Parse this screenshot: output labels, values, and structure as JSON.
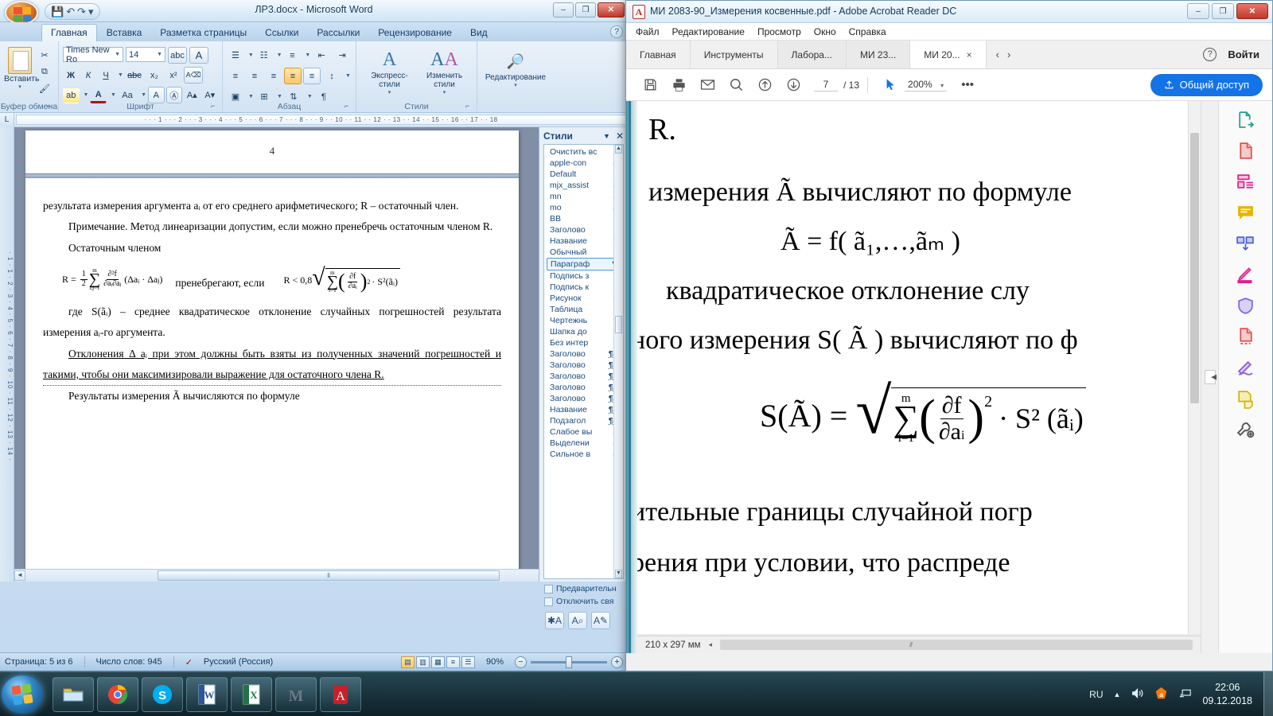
{
  "word": {
    "title": "ЛР3.docx - Microsoft Word",
    "quick_access": {
      "save": "💾",
      "undo": "↶",
      "redo": "↷",
      "more": "▾"
    },
    "window_buttons": {
      "minimize": "–",
      "maximize": "❐",
      "close": "✕"
    },
    "tabs": [
      {
        "label": "Главная",
        "active": true
      },
      {
        "label": "Вставка",
        "active": false
      },
      {
        "label": "Разметка страницы",
        "active": false
      },
      {
        "label": "Ссылки",
        "active": false
      },
      {
        "label": "Рассылки",
        "active": false
      },
      {
        "label": "Рецензирование",
        "active": false
      },
      {
        "label": "Вид",
        "active": false
      }
    ],
    "help_label": "?",
    "ribbon": {
      "clipboard": {
        "label": "Буфер обмена",
        "paste": "Вставить",
        "cut": "✂",
        "copy": "⧉",
        "format_painter": "🖌"
      },
      "font": {
        "label": "Шрифт",
        "font_name": "Times New Ro",
        "font_size": "14",
        "bold": "Ж",
        "italic": "К",
        "underline": "Ч",
        "strike": "abc",
        "subscript": "x₂",
        "superscript": "x²",
        "clear_format": "A",
        "change_case": "Aa",
        "text_highlight": "ab",
        "font_color": "A",
        "grow_font": "A▴",
        "shrink_font": "A▾",
        "text_effects": "A",
        "enclose": "Ⓐ"
      },
      "paragraph": {
        "label": "Абзац",
        "bullets": "☰",
        "numbering": "☷",
        "multilevel": "≡",
        "decrease_indent": "⇤",
        "increase_indent": "⇥",
        "align_left": "≡",
        "align_center": "≡",
        "align_right": "≡",
        "justify": "≡",
        "line_spacing": "↕",
        "shading": "▣",
        "borders": "⊞",
        "sort": "⇅",
        "show_marks": "¶"
      },
      "styles": {
        "label": "Стили",
        "quick_styles": "Экспресс-стили",
        "change_styles": "Изменить стили"
      },
      "editing": {
        "label": "Редактирование",
        "find": "Редактирование"
      }
    },
    "ruler": {
      "tab_selector": "L",
      "horizontal": "· · · 1 · · · 2 · · · 3 · · · 4 · · · 5 · · · 6 · · · 7 · · · 8 · · · 9 · · 10 · · 11 · · 12 · · 13 · · 14 · · 15 · · 16 · · 17 · · 18",
      "vertical": "· 1 · 1 · 2 · 3 · 4 · 5 · 6 · 7 · 8 · 9 · 10 · 11 · 12 · 13 · 14 ·"
    },
    "document": {
      "page_number_header": "4",
      "paragraphs": [
        "результата измерения аргумента aᵢ от его среднего арифметического; R – остаточный член.",
        "Примечание. Метод линеаризации допустим, если можно пренебречь остаточным членом R.",
        "Остаточным членом",
        "пренебрегают, если",
        "где S(ãᵢ) – среднее квадратическое отклонение случайных погрешностей результата измерения aᵢ-го аргумента.",
        "Отклонения Δ aᵢ при этом должны быть взяты из полученных значений погрешностей и такими, чтобы они максимизировали выражение для остаточного члена R.",
        "Результаты измерения Ã вычисляются по формуле"
      ],
      "formula_left": "R = 1/2 ∑(i,j=1..m) ∂²f/∂aᵢ∂aⱼ (Δaᵢ · Δaⱼ)",
      "formula_right": "R < 0,8 √(∑(i=1..m) (∂f/∂aᵢ)² · S²(ãᵢ))",
      "formula_parts": {
        "R": "R",
        "eq": "=",
        "half_num": "1",
        "half_den": "2",
        "sigma": "∑",
        "sigma_top": "m",
        "sigma_bot": "i,j=1",
        "d2f": "∂²f",
        "dadaj": "∂aᵢ∂aⱼ",
        "delta_expr": "(Δaᵢ · Δaⱼ)",
        "rlt": "R < 0,8",
        "radical": "√",
        "sigma2_top": "m",
        "sigma2_bot": "i=1",
        "df": "∂f",
        "dai": "∂aᵢ",
        "pow2": "2",
        "s2ai": "· S²(ãᵢ)"
      }
    },
    "styles_pane": {
      "title": "Стили",
      "dropdown": "▼",
      "close": "✕",
      "items": [
        {
          "label": "Очистить вс",
          "mark": ""
        },
        {
          "label": "apple-con",
          "mark": "a"
        },
        {
          "label": "Default",
          "mark": "¶"
        },
        {
          "label": "mjx_assist",
          "mark": "a"
        },
        {
          "label": "mn",
          "mark": "a"
        },
        {
          "label": "mo",
          "mark": "a"
        },
        {
          "label": "BB",
          "mark": "¶"
        },
        {
          "label": "Заголово",
          "mark": "¶"
        },
        {
          "label": "Название",
          "mark": "¶"
        },
        {
          "label": "Обычный",
          "mark": "¶"
        },
        {
          "label": "Параграф",
          "mark": "¶",
          "selected": true
        },
        {
          "label": "Подпись з",
          "mark": "¶"
        },
        {
          "label": "Подпись к",
          "mark": "¶"
        },
        {
          "label": "Рисунок",
          "mark": "¶"
        },
        {
          "label": "Таблица",
          "mark": "¶"
        },
        {
          "label": "Чертежнь",
          "mark": "¶"
        },
        {
          "label": "Шапка до",
          "mark": "¶"
        },
        {
          "label": "Без интер",
          "mark": "¶"
        },
        {
          "label": "Заголово",
          "mark": "¶a"
        },
        {
          "label": "Заголово",
          "mark": "¶a"
        },
        {
          "label": "Заголово",
          "mark": "¶a"
        },
        {
          "label": "Заголово",
          "mark": "¶a"
        },
        {
          "label": "Заголово",
          "mark": "¶a"
        },
        {
          "label": "Название",
          "mark": "¶a"
        },
        {
          "label": "Подзагол",
          "mark": "¶a"
        },
        {
          "label": "Слабое вы",
          "mark": "a"
        },
        {
          "label": "Выделени",
          "mark": "a"
        },
        {
          "label": "Сильное в",
          "mark": "a"
        }
      ],
      "checkboxes": [
        {
          "label": "Предварительн"
        },
        {
          "label": "Отключить свя"
        }
      ],
      "buttons": [
        {
          "icon": "✱A",
          "name": "new-style"
        },
        {
          "icon": "A⌕",
          "name": "style-inspector"
        },
        {
          "icon": "A✎",
          "name": "manage-styles"
        }
      ]
    },
    "status_bar": {
      "page": "Страница: 5 из 6",
      "words": "Число слов: 945",
      "proofing_icon": "✓",
      "language": "Русский (Россия)",
      "zoom": "90%",
      "zoom_out": "−",
      "zoom_in": "+",
      "views": [
        "▤",
        "▥",
        "▦",
        "≡",
        "☰"
      ]
    }
  },
  "acrobat": {
    "title": "МИ 2083-90_Измерения косвенные.pdf - Adobe Acrobat Reader DC",
    "app_icon": "A",
    "window_buttons": {
      "minimize": "–",
      "maximize": "❐",
      "close": "✕"
    },
    "menu": [
      "Файл",
      "Редактирование",
      "Просмотр",
      "Окно",
      "Справка"
    ],
    "tabs": [
      {
        "label": "Главная",
        "type": "home"
      },
      {
        "label": "Инструменты",
        "type": "tools"
      },
      {
        "label": "Лабора...",
        "type": "doc"
      },
      {
        "label": "МИ 23...",
        "type": "doc"
      },
      {
        "label": "МИ 20...",
        "type": "doc",
        "active": true,
        "close": "×"
      }
    ],
    "nav": {
      "prev": "‹",
      "next": "›",
      "help": "?"
    },
    "sign_in": "Войти",
    "toolbar": {
      "save_icon": "save-icon",
      "print_icon": "print-icon",
      "email_icon": "email-icon",
      "search_icon": "search-icon",
      "prev_page_icon": "arrow-up-circle-icon",
      "next_page_icon": "arrow-down-circle-icon",
      "page_current": "7",
      "page_total": "/ 13",
      "select_tool": "cursor-icon",
      "zoom": "200%",
      "zoom_caret": "▾",
      "more": "•••",
      "share_label": "Общий доступ",
      "share_icon": "↑"
    },
    "pdf_content": {
      "lines": [
        "R.",
        "измерения Ã  вычисляют по формуле",
        "Ã = f( ã₁,…,ãₘ )",
        "квадратическое    отклонение    слу",
        "ного измерения S( Ã ) вычисляют по ф",
        "S(Ã) = √( ∑(i=1..m) (∂f/∂aᵢ)² · S²(ãᵢ) )",
        "ительные   границы   случайной   погр",
        "рения   при   условии,   что   распреде"
      ],
      "formula2": {
        "lhs": "S(Ã) =",
        "radical": "√",
        "sigma": "∑",
        "sigma_top": "m",
        "sigma_bot": "i=1",
        "num": "∂f",
        "den": "∂a",
        "den_sub": "i",
        "pow": "2",
        "tail": "· S² (ãᵢ)"
      },
      "formula1": "Ã = f( ã₁,…,ãₘ )"
    },
    "right_tools": [
      {
        "name": "export-pdf-icon",
        "color": "#2a9d8f"
      },
      {
        "name": "create-pdf-icon",
        "color": "#e05252"
      },
      {
        "name": "organize-pages-icon",
        "color": "#e0218a"
      },
      {
        "name": "comment-icon",
        "color": "#e8b400"
      },
      {
        "name": "combine-files-icon",
        "color": "#4a5fd0"
      },
      {
        "name": "highlight-icon",
        "color": "#e0218a"
      },
      {
        "name": "protect-icon",
        "color": "#7b68ee"
      },
      {
        "name": "compress-pdf-icon",
        "color": "#e05252"
      },
      {
        "name": "fill-sign-icon",
        "color": "#8e5fe0"
      },
      {
        "name": "stamp-icon",
        "color": "#d4b106"
      },
      {
        "name": "more-tools-icon",
        "color": "#5a5a5a"
      }
    ],
    "status": {
      "page_size": "210 x 297 мм",
      "prev_arrow": "◂"
    }
  },
  "taskbar": {
    "start": "start-orb",
    "items": [
      {
        "name": "explorer-icon"
      },
      {
        "name": "chrome-icon"
      },
      {
        "name": "skype-icon"
      },
      {
        "name": "word-icon"
      },
      {
        "name": "excel-icon"
      },
      {
        "name": "mathcad-icon"
      },
      {
        "name": "acrobat-icon"
      }
    ],
    "tray": {
      "language": "RU",
      "show_hidden": "▲",
      "volume": "volume-icon",
      "antivirus": "avast-icon",
      "network": "network-icon",
      "time": "22:06",
      "date": "09.12.2018"
    }
  }
}
